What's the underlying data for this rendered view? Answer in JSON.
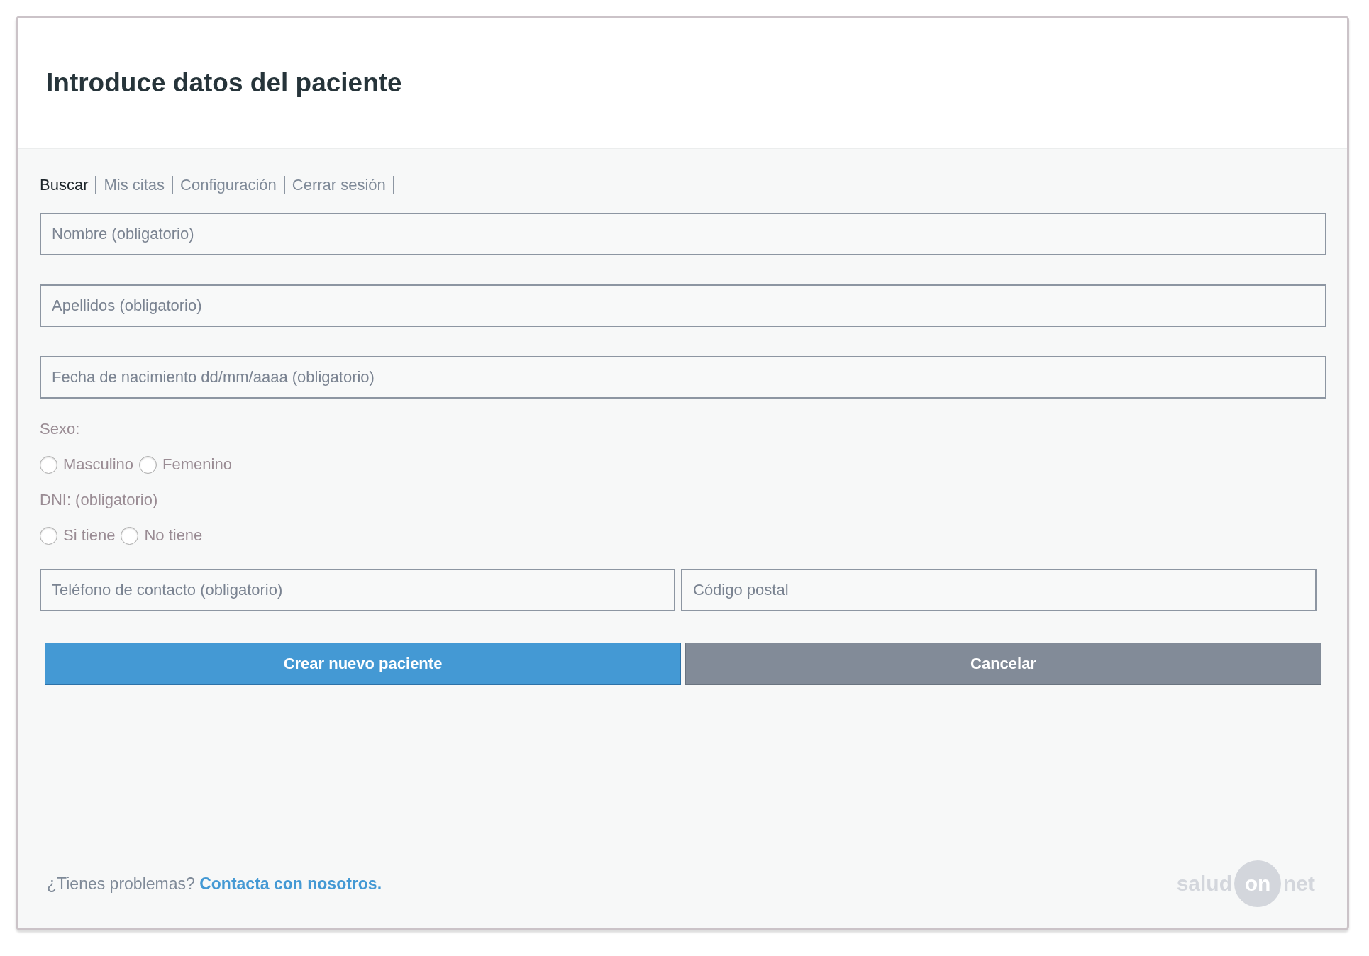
{
  "title": "Introduce datos del paciente",
  "nav": [
    {
      "label": "Buscar",
      "selected": true
    },
    {
      "label": "Mis citas",
      "selected": false
    },
    {
      "label": "Configuración",
      "selected": false
    },
    {
      "label": "Cerrar sesión",
      "selected": false
    }
  ],
  "fields": [
    {
      "placeholder": "Nombre (obligatorio)"
    },
    {
      "placeholder": "Apellidos (obligatorio)"
    },
    {
      "placeholder": "Fecha de nacimiento dd/mm/aaaa (obligatorio)"
    }
  ],
  "radio_groups": [
    {
      "label": "Sexo:",
      "options": [
        {
          "label": "Masculino",
          "selected": false
        },
        {
          "label": "Femenino",
          "selected": false
        }
      ]
    },
    {
      "label": "DNI: (obligatorio)",
      "options": [
        {
          "label": "Si tiene",
          "selected": false
        },
        {
          "label": "No tiene",
          "selected": false
        }
      ]
    }
  ],
  "contact_fields": [
    {
      "placeholder": "Teléfono de contacto (obligatorio)"
    },
    {
      "placeholder": "Código postal"
    }
  ],
  "buttons": [
    {
      "label": "Crear nuevo paciente",
      "kind": "primary"
    },
    {
      "label": "Cancelar",
      "kind": "secondary"
    }
  ],
  "footer": {
    "text": "¿Tienes problemas?",
    "link": "Contacta con nosotros."
  },
  "logo": {
    "left": "salud",
    "middle": "on",
    "right": "net"
  }
}
